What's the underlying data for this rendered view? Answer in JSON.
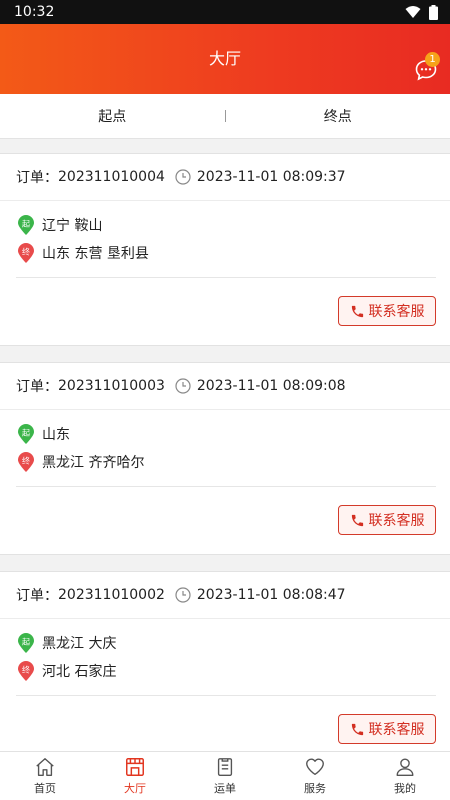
{
  "status": {
    "time": "10:32"
  },
  "header": {
    "title": "大厅",
    "message_badge": "1"
  },
  "filters": {
    "start": "起点",
    "end": "终点",
    "separator": "|"
  },
  "orders": [
    {
      "label": "订单：",
      "number": "202311010004",
      "time": "2023-11-01 08:09:37",
      "start_tag": "起",
      "end_tag": "终",
      "from": "辽宁 鞍山",
      "to": "山东 东营 垦利县",
      "contact": "联系客服"
    },
    {
      "label": "订单：",
      "number": "202311010003",
      "time": "2023-11-01 08:09:08",
      "start_tag": "起",
      "end_tag": "终",
      "from": "山东",
      "to": "黑龙江 齐齐哈尔",
      "contact": "联系客服"
    },
    {
      "label": "订单：",
      "number": "202311010002",
      "time": "2023-11-01 08:08:47",
      "start_tag": "起",
      "end_tag": "终",
      "from": "黑龙江 大庆",
      "to": "河北 石家庄",
      "contact": "联系客服"
    }
  ],
  "tabs": [
    {
      "label": "首页",
      "icon": "home-icon"
    },
    {
      "label": "大厅",
      "icon": "hall-icon",
      "active": true
    },
    {
      "label": "运单",
      "icon": "waybill-icon"
    },
    {
      "label": "服务",
      "icon": "heart-icon"
    },
    {
      "label": "我的",
      "icon": "user-icon"
    }
  ],
  "colors": {
    "accent": "#e2351f",
    "start_pin": "#3bb54a",
    "end_pin": "#e84b4b"
  }
}
